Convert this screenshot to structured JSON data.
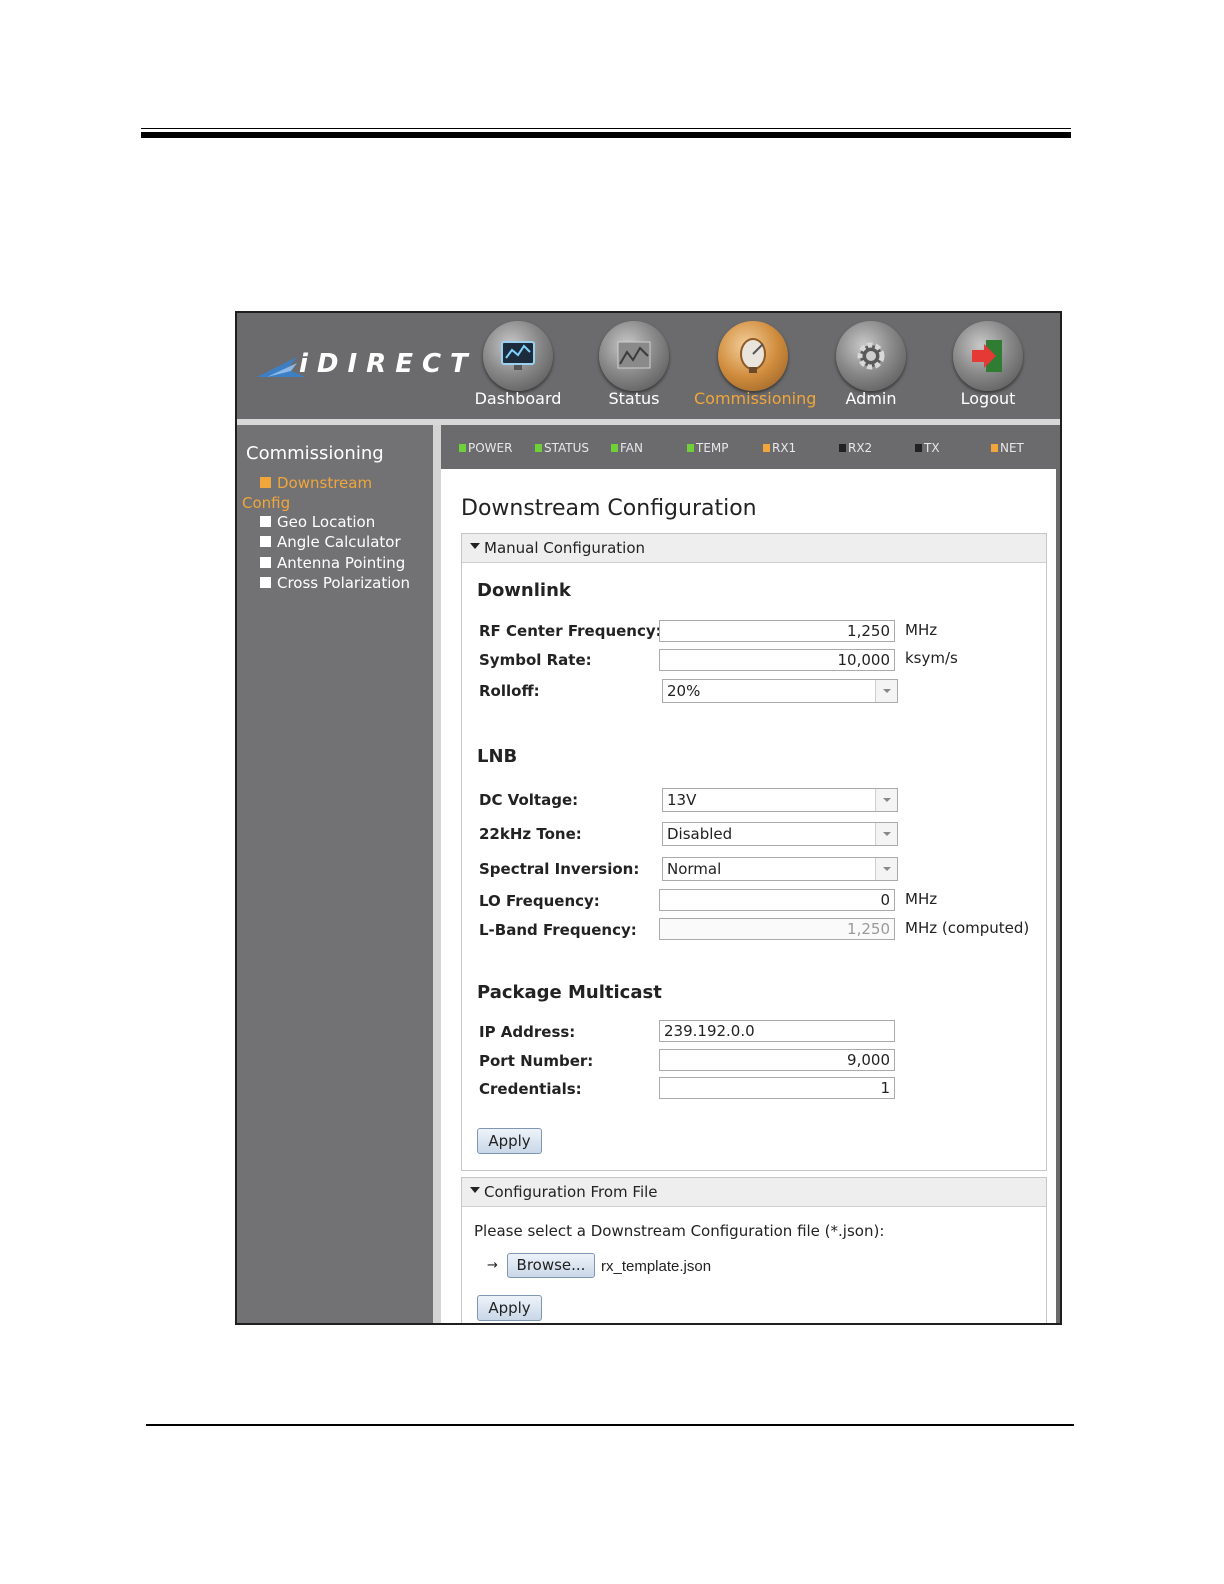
{
  "header": {
    "logo_text": "iDIRECT",
    "nav": [
      {
        "label": "Dashboard",
        "icon": "monitor-icon"
      },
      {
        "label": "Status",
        "icon": "chart-icon"
      },
      {
        "label": "Commissioning",
        "icon": "satellite-dish-icon",
        "active": true
      },
      {
        "label": "Admin",
        "icon": "gear-icon"
      },
      {
        "label": "Logout",
        "icon": "logout-icon"
      }
    ]
  },
  "sidebar": {
    "title": "Commissioning",
    "items": [
      {
        "label": "Downstream",
        "label2": "Config",
        "active": true
      },
      {
        "label": "Geo Location"
      },
      {
        "label": "Angle Calculator"
      },
      {
        "label": "Antenna Pointing"
      },
      {
        "label": "Cross Polarization"
      }
    ]
  },
  "status_leds": [
    {
      "label": "POWER",
      "color": "#6fd13a"
    },
    {
      "label": "STATUS",
      "color": "#6fd13a"
    },
    {
      "label": "FAN",
      "color": "#6fd13a"
    },
    {
      "label": "TEMP",
      "color": "#6fd13a"
    },
    {
      "label": "RX1",
      "color": "#f0a63a"
    },
    {
      "label": "RX2",
      "color": "#222222"
    },
    {
      "label": "TX",
      "color": "#222222"
    },
    {
      "label": "NET",
      "color": "#f0a63a"
    }
  ],
  "page": {
    "title": "Downstream Configuration"
  },
  "manual": {
    "panel_title": "Manual Configuration",
    "downlink": {
      "title": "Downlink",
      "rf_center_label": "RF Center Frequency:",
      "rf_center_value": "1,250",
      "rf_center_unit": "MHz",
      "symbol_rate_label": "Symbol Rate:",
      "symbol_rate_value": "10,000",
      "symbol_rate_unit": "ksym/s",
      "rolloff_label": "Rolloff:",
      "rolloff_value": "20%"
    },
    "lnb": {
      "title": "LNB",
      "dc_voltage_label": "DC Voltage:",
      "dc_voltage_value": "13V",
      "tone_label": "22kHz Tone:",
      "tone_value": "Disabled",
      "spectral_label": "Spectral Inversion:",
      "spectral_value": "Normal",
      "lo_label": "LO Frequency:",
      "lo_value": "0",
      "lo_unit": "MHz",
      "lband_label": "L-Band Frequency:",
      "lband_value": "1,250",
      "lband_unit": "MHz (computed)"
    },
    "multicast": {
      "title": "Package Multicast",
      "ip_label": "IP Address:",
      "ip_value": "239.192.0.0",
      "port_label": "Port Number:",
      "port_value": "9,000",
      "cred_label": "Credentials:",
      "cred_value": "1"
    },
    "apply_label": "Apply"
  },
  "file_config": {
    "panel_title": "Configuration From File",
    "note": "Please select a Downstream Configuration file (*.json):",
    "arrow": "→",
    "browse_label": "Browse...",
    "file_name": "rx_template.json",
    "apply_label": "Apply"
  }
}
